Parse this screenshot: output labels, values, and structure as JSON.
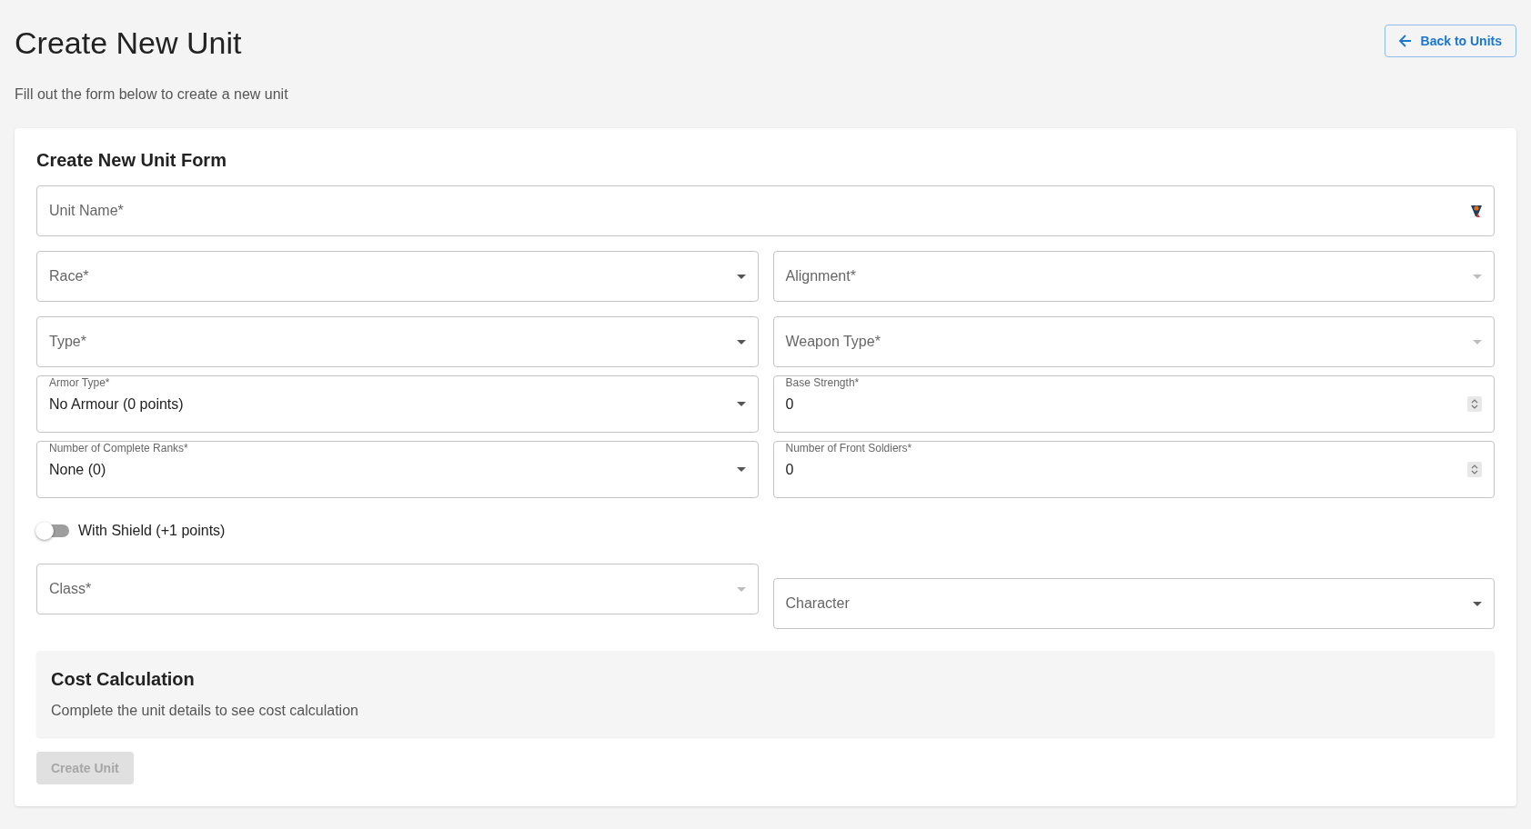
{
  "header": {
    "title": "Create New Unit",
    "subtitle": "Fill out the form below to create a new unit",
    "back_button": {
      "label": "Back to Units"
    }
  },
  "form": {
    "title": "Create New Unit Form",
    "rows": [
      [
        {
          "kind": "text",
          "label": "Unit Name*"
        }
      ],
      [
        {
          "kind": "select",
          "label": "Race*",
          "disabled": false
        },
        {
          "kind": "select",
          "label": "Alignment*",
          "disabled": true
        }
      ],
      [
        {
          "kind": "select",
          "label": "Type*",
          "disabled": false
        },
        {
          "kind": "select",
          "label": "Weapon Type*",
          "disabled": true
        }
      ],
      [
        {
          "kind": "select",
          "label": "Armor Type*",
          "value": "No Armour (0 points)",
          "disabled": false
        },
        {
          "kind": "number",
          "label": "Base Strength*",
          "value": "0"
        }
      ],
      [
        {
          "kind": "select",
          "label": "Number of Complete Ranks*",
          "value": "None (0)",
          "disabled": false
        },
        {
          "kind": "number",
          "label": "Number of Front Soldiers*",
          "value": "0"
        }
      ],
      [
        {
          "kind": "switch",
          "label": "With Shield (+1 points)",
          "on": false
        }
      ],
      [
        {
          "kind": "select",
          "label": "Class*",
          "disabled": true
        },
        {
          "kind": "select",
          "label": "Character",
          "disabled": false
        }
      ]
    ],
    "cost": {
      "title": "Cost Calculation",
      "message": "Complete the unit details to see cost calculation"
    },
    "submit": {
      "label": "Create Unit",
      "disabled": true
    }
  }
}
